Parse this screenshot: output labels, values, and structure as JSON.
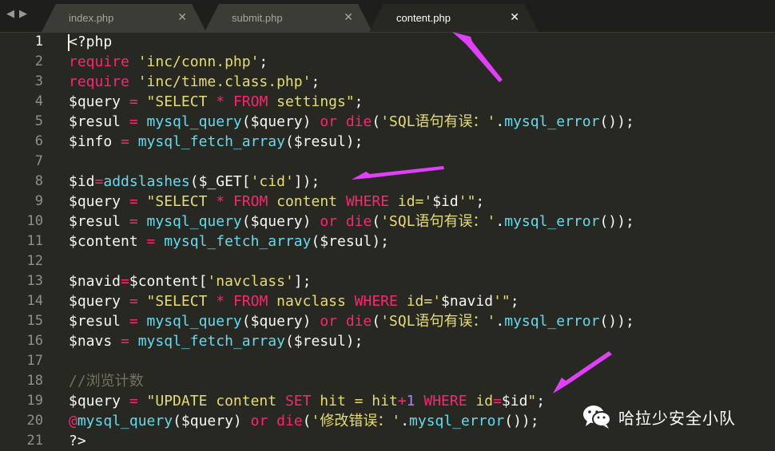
{
  "tabbar": {
    "back_arrow": "◀",
    "forward_arrow": "▶",
    "tabs": [
      {
        "label": "index.php",
        "active": false
      },
      {
        "label": "submit.php",
        "active": false
      },
      {
        "label": "content.php",
        "active": true
      }
    ],
    "close_glyph": "✕"
  },
  "theme": {
    "keyword": "#f92672",
    "string": "#e6db74",
    "function": "#66d9ef",
    "number": "#ae81ff",
    "comment": "#75715e",
    "plain": "#f8f8f2",
    "annotation_arrow": "#e040fb"
  },
  "code_lines": [
    [
      [
        "p",
        "<?php"
      ]
    ],
    [
      [
        "k",
        "require"
      ],
      [
        "p",
        " "
      ],
      [
        "s",
        "'inc/conn.php'"
      ],
      [
        "p",
        ";"
      ]
    ],
    [
      [
        "k",
        "require"
      ],
      [
        "p",
        " "
      ],
      [
        "s",
        "'inc/time.class.php'"
      ],
      [
        "p",
        ";"
      ]
    ],
    [
      [
        "p",
        "$query "
      ],
      [
        "k",
        "="
      ],
      [
        "p",
        " "
      ],
      [
        "s",
        "\"SELECT "
      ],
      [
        "k",
        "*"
      ],
      [
        "s",
        " "
      ],
      [
        "k",
        "FROM"
      ],
      [
        "s",
        " settings\""
      ],
      [
        "p",
        ";"
      ]
    ],
    [
      [
        "p",
        "$resul "
      ],
      [
        "k",
        "="
      ],
      [
        "p",
        " "
      ],
      [
        "f",
        "mysql_query"
      ],
      [
        "p",
        "($query) "
      ],
      [
        "k",
        "or"
      ],
      [
        "p",
        " "
      ],
      [
        "k",
        "die"
      ],
      [
        "p",
        "("
      ],
      [
        "s",
        "'SQL语句有误：'"
      ],
      [
        "p",
        "."
      ],
      [
        "f",
        "mysql_error"
      ],
      [
        "p",
        "());"
      ]
    ],
    [
      [
        "p",
        "$info "
      ],
      [
        "k",
        "="
      ],
      [
        "p",
        " "
      ],
      [
        "f",
        "mysql_fetch_array"
      ],
      [
        "p",
        "($resul);"
      ]
    ],
    [],
    [
      [
        "p",
        "$id"
      ],
      [
        "k",
        "="
      ],
      [
        "f",
        "addslashes"
      ],
      [
        "p",
        "($_GET["
      ],
      [
        "s",
        "'cid'"
      ],
      [
        "p",
        "]);"
      ]
    ],
    [
      [
        "p",
        "$query "
      ],
      [
        "k",
        "="
      ],
      [
        "p",
        " "
      ],
      [
        "s",
        "\"SELECT "
      ],
      [
        "k",
        "*"
      ],
      [
        "s",
        " "
      ],
      [
        "k",
        "FROM"
      ],
      [
        "s",
        " content "
      ],
      [
        "k",
        "WHERE"
      ],
      [
        "s",
        " id='"
      ],
      [
        "p",
        "$id"
      ],
      [
        "s",
        "'\""
      ],
      [
        "p",
        ";"
      ]
    ],
    [
      [
        "p",
        "$resul "
      ],
      [
        "k",
        "="
      ],
      [
        "p",
        " "
      ],
      [
        "f",
        "mysql_query"
      ],
      [
        "p",
        "($query) "
      ],
      [
        "k",
        "or"
      ],
      [
        "p",
        " "
      ],
      [
        "k",
        "die"
      ],
      [
        "p",
        "("
      ],
      [
        "s",
        "'SQL语句有误：'"
      ],
      [
        "p",
        "."
      ],
      [
        "f",
        "mysql_error"
      ],
      [
        "p",
        "());"
      ]
    ],
    [
      [
        "p",
        "$content "
      ],
      [
        "k",
        "="
      ],
      [
        "p",
        " "
      ],
      [
        "f",
        "mysql_fetch_array"
      ],
      [
        "p",
        "($resul);"
      ]
    ],
    [],
    [
      [
        "p",
        "$navid"
      ],
      [
        "k",
        "="
      ],
      [
        "p",
        "$content["
      ],
      [
        "s",
        "'navclass'"
      ],
      [
        "p",
        "];"
      ]
    ],
    [
      [
        "p",
        "$query "
      ],
      [
        "k",
        "="
      ],
      [
        "p",
        " "
      ],
      [
        "s",
        "\"SELECT "
      ],
      [
        "k",
        "*"
      ],
      [
        "s",
        " "
      ],
      [
        "k",
        "FROM"
      ],
      [
        "s",
        " navclass "
      ],
      [
        "k",
        "WHERE"
      ],
      [
        "s",
        " id='"
      ],
      [
        "p",
        "$navid"
      ],
      [
        "s",
        "'\""
      ],
      [
        "p",
        ";"
      ]
    ],
    [
      [
        "p",
        "$resul "
      ],
      [
        "k",
        "="
      ],
      [
        "p",
        " "
      ],
      [
        "f",
        "mysql_query"
      ],
      [
        "p",
        "($query) "
      ],
      [
        "k",
        "or"
      ],
      [
        "p",
        " "
      ],
      [
        "k",
        "die"
      ],
      [
        "p",
        "("
      ],
      [
        "s",
        "'SQL语句有误：'"
      ],
      [
        "p",
        "."
      ],
      [
        "f",
        "mysql_error"
      ],
      [
        "p",
        "());"
      ]
    ],
    [
      [
        "p",
        "$navs "
      ],
      [
        "k",
        "="
      ],
      [
        "p",
        " "
      ],
      [
        "f",
        "mysql_fetch_array"
      ],
      [
        "p",
        "($resul);"
      ]
    ],
    [],
    [
      [
        "c",
        "//浏览计数"
      ]
    ],
    [
      [
        "p",
        "$query "
      ],
      [
        "k",
        "="
      ],
      [
        "p",
        " "
      ],
      [
        "s",
        "\"UPDATE content "
      ],
      [
        "k",
        "SET"
      ],
      [
        "s",
        " hit = hit"
      ],
      [
        "k",
        "+"
      ],
      [
        "n",
        "1"
      ],
      [
        "s",
        " "
      ],
      [
        "k",
        "WHERE"
      ],
      [
        "s",
        " id"
      ],
      [
        "k",
        "="
      ],
      [
        "p",
        "$id"
      ],
      [
        "s",
        "\""
      ],
      [
        "p",
        ";"
      ]
    ],
    [
      [
        "k",
        "@"
      ],
      [
        "f",
        "mysql_query"
      ],
      [
        "p",
        "($query) "
      ],
      [
        "k",
        "or"
      ],
      [
        "p",
        " "
      ],
      [
        "k",
        "die"
      ],
      [
        "p",
        "("
      ],
      [
        "s",
        "'修改错误：'"
      ],
      [
        "p",
        "."
      ],
      [
        "f",
        "mysql_error"
      ],
      [
        "p",
        "());"
      ]
    ],
    [
      [
        "p",
        "?>"
      ]
    ]
  ],
  "line_numbers": [
    "1",
    "2",
    "3",
    "4",
    "5",
    "6",
    "7",
    "8",
    "9",
    "10",
    "11",
    "12",
    "13",
    "14",
    "15",
    "16",
    "17",
    "18",
    "19",
    "20",
    "21"
  ],
  "watermark": {
    "icon": "wechat-icon",
    "text": "哈拉少安全小队"
  }
}
